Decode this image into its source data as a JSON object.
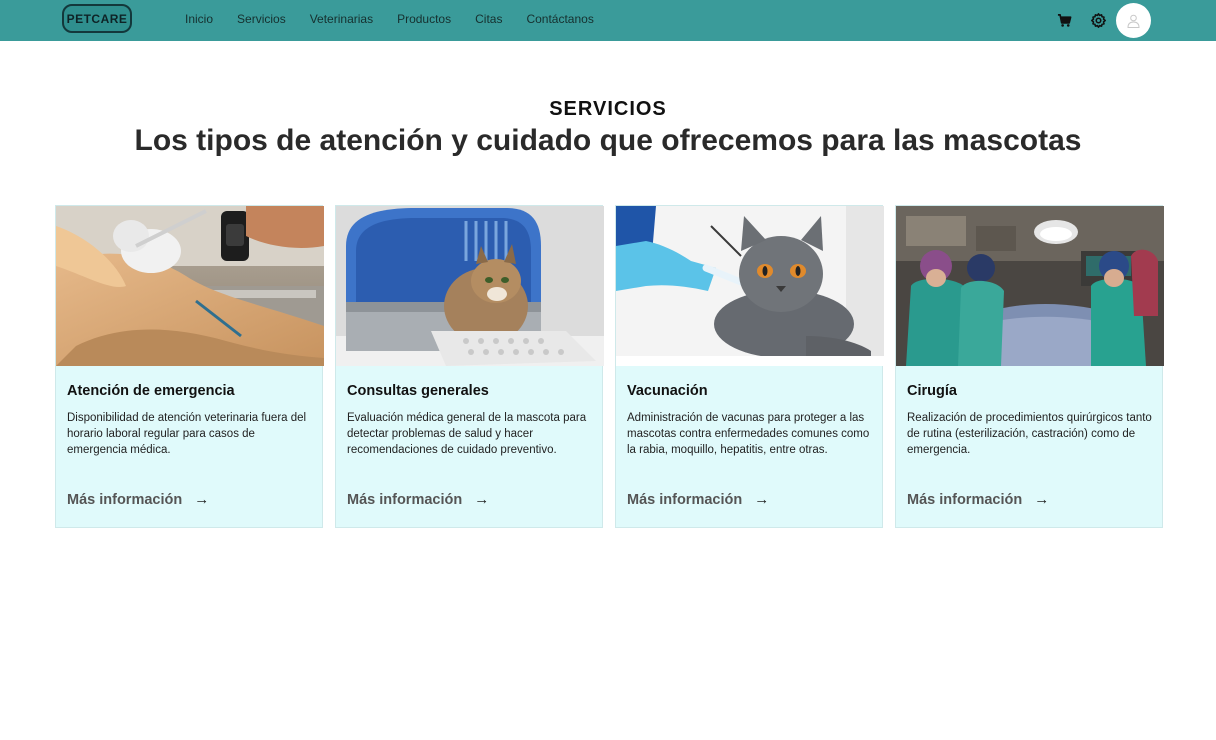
{
  "brand": {
    "logo_text": "PETCARE"
  },
  "nav": {
    "links": [
      "Inicio",
      "Servicios",
      "Veterinarias",
      "Productos",
      "Citas",
      "Contáctanos"
    ],
    "icons": [
      "cart-icon",
      "gear-icon",
      "user-icon"
    ]
  },
  "section": {
    "label": "SERVICIOS",
    "title": "Los tipos de atención y cuidado que ofrecemos para las mascotas"
  },
  "cards": [
    {
      "title": "Atención de emergencia",
      "description": "Disponibilidad de atención veterinaria fuera del horario laboral regular para casos de emergencia médica.",
      "link": "Más información",
      "image": "veterinarian-with-injured-dog-photo"
    },
    {
      "title": "Consultas generales",
      "description": "Evaluación médica general de la mascota para detectar problemas de salud y hacer recomendaciones de cuidado preventivo.",
      "link": "Más información",
      "image": "cat-in-pet-carrier-photo"
    },
    {
      "title": "Vacunación",
      "description": "Administración de vacunas para proteger a las mascotas contra enfermedades comunes como la rabia, moquillo, hepatitis, entre otras.",
      "link": "Más información",
      "image": "cat-getting-vaccine-photo"
    },
    {
      "title": "Cirugía",
      "description": "Realización de procedimientos quirúrgicos tanto de rutina (esterilización, castración) como de emergencia.",
      "link": "Más información",
      "image": "veterinary-surgery-room-photo"
    }
  ],
  "colors": {
    "navbar": "#3a9b9a",
    "card_background": "#e0fafb",
    "title_text": "#2a2a2a"
  }
}
